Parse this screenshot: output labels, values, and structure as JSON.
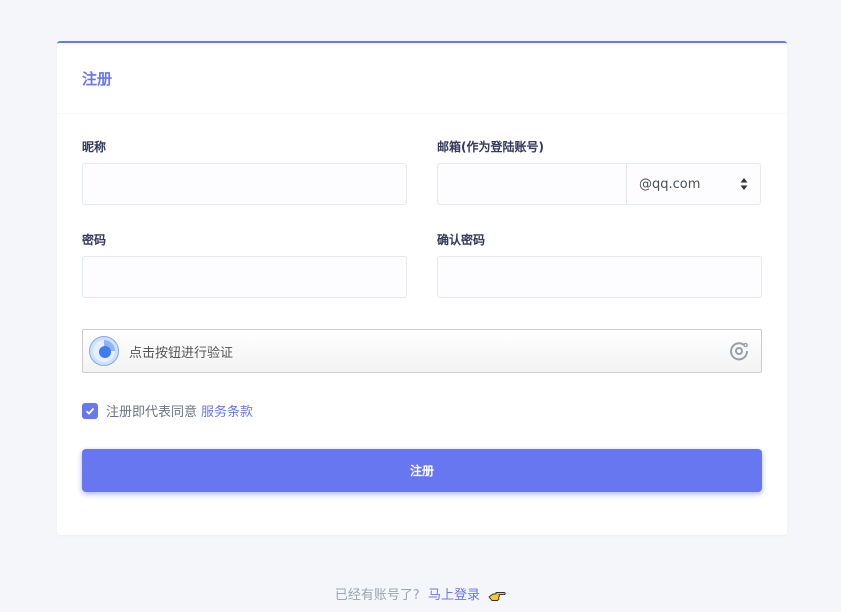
{
  "card": {
    "title": "注册",
    "accent_color": "#6777ef"
  },
  "form": {
    "nickname_label": "昵称",
    "nickname_value": "",
    "email_label": "邮箱(作为登陆账号)",
    "email_value": "",
    "email_domain_selected": "@qq.com",
    "password_label": "密码",
    "password_value": "",
    "confirm_label": "确认密码",
    "confirm_value": ""
  },
  "captcha": {
    "text": "点击按钮进行验证",
    "icon": "captcha-logo-icon"
  },
  "agreement": {
    "checked": true,
    "text": "注册即代表同意",
    "link": "服务条款"
  },
  "submit": {
    "label": "注册"
  },
  "footer": {
    "text": "已经有账号了?",
    "link": "马上登录",
    "icon": "pointing-hand-icon"
  }
}
